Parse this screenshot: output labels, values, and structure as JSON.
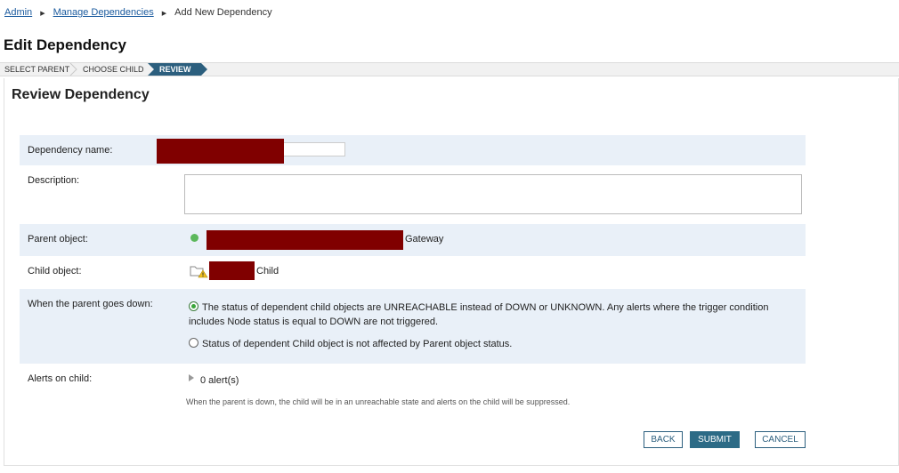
{
  "breadcrumb": {
    "admin": "Admin",
    "manage": "Manage Dependencies",
    "current": "Add New Dependency"
  },
  "page_title": "Edit Dependency",
  "wizard": {
    "step1": "SELECT PARENT",
    "step2": "CHOOSE CHILD",
    "step3": "REVIEW"
  },
  "section_title": "Review Dependency",
  "form": {
    "dependency_name_label": "Dependency name:",
    "description_label": "Description:",
    "parent_label": "Parent object:",
    "parent_suffix": "Gateway",
    "child_label": "Child object:",
    "child_suffix": "Child",
    "parent_down_label": "When the parent goes down:",
    "option1_line1": "The status of dependent child objects are UNREACHABLE instead of DOWN or UNKNOWN. Any alerts where the trigger condition",
    "option1_line2": "includes Node status is equal to DOWN are not triggered.",
    "option2": "Status of dependent Child object is not affected by Parent object status.",
    "alerts_label": "Alerts on child:",
    "alerts_count": "0 alert(s)",
    "note": "When the parent is down, the child will be in an unreachable state and alerts on the child will be suppressed."
  },
  "buttons": {
    "back": "BACK",
    "submit": "SUBMIT",
    "cancel": "CANCEL"
  },
  "colors": {
    "accent": "#2c5f7e",
    "redaction": "#800000",
    "status_up": "#5cb85c"
  }
}
